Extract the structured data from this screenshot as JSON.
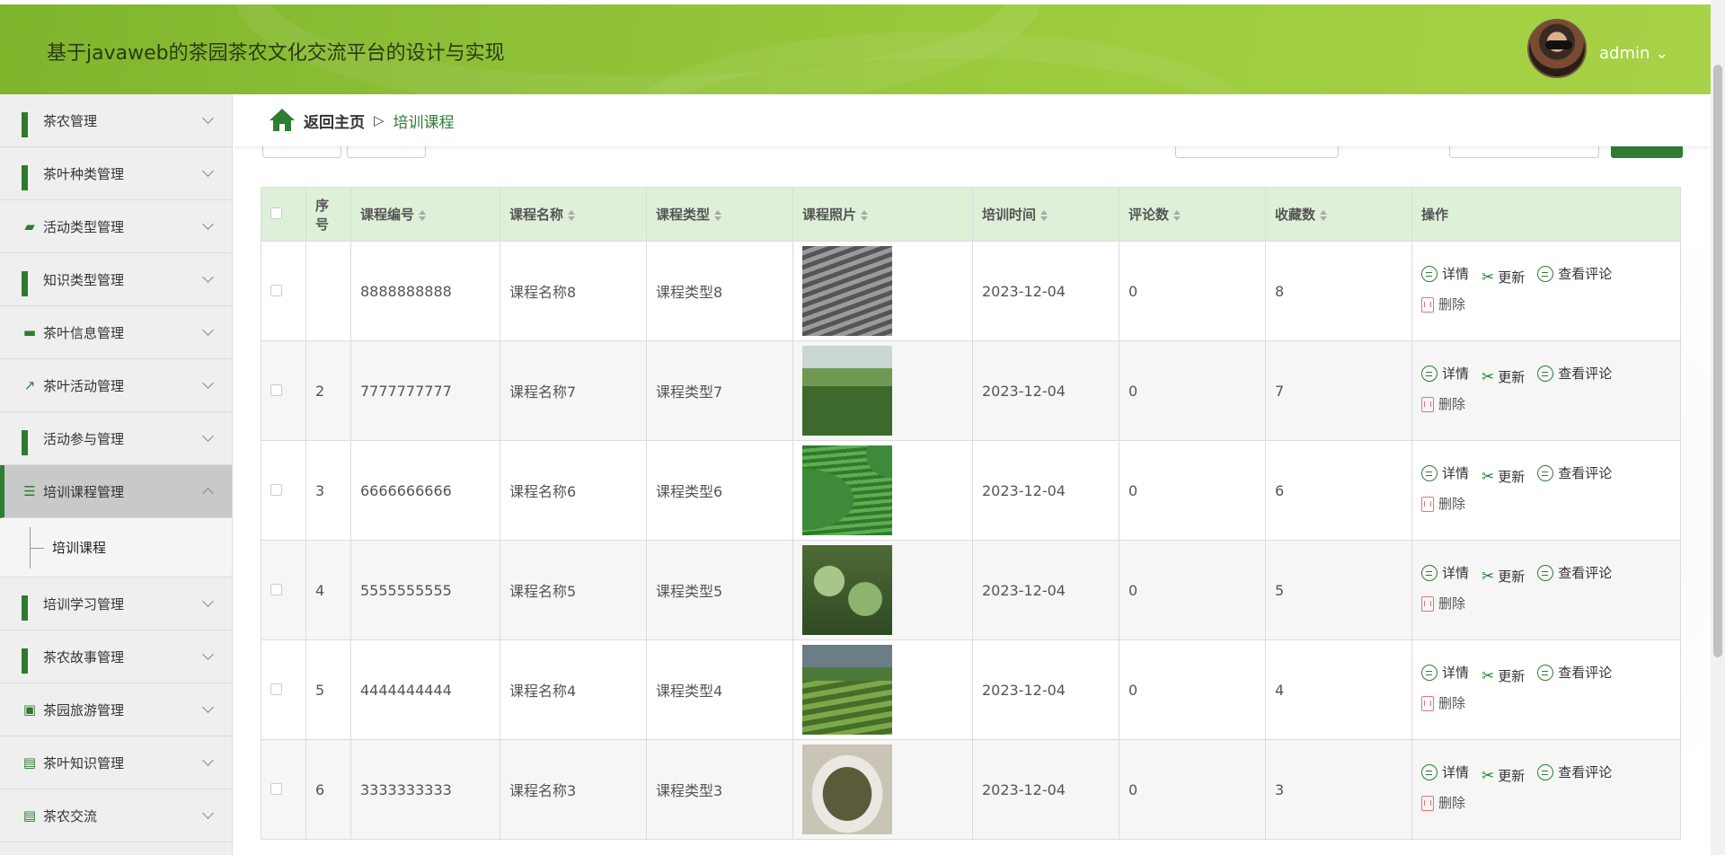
{
  "app": {
    "title": "基于javaweb的茶园茶农文化交流平台的设计与实现",
    "user": "admin ⌄"
  },
  "sidebar": {
    "items": [
      {
        "label": "茶农管理",
        "icon": "grid-icon"
      },
      {
        "label": "茶叶种类管理",
        "icon": "grid-icon"
      },
      {
        "label": "活动类型管理",
        "icon": "ticket-icon"
      },
      {
        "label": "知识类型管理",
        "icon": "grid-icon"
      },
      {
        "label": "茶叶信息管理",
        "icon": "comment-icon"
      },
      {
        "label": "茶叶活动管理",
        "icon": "chart-icon"
      },
      {
        "label": "活动参与管理",
        "icon": "grid-icon"
      },
      {
        "label": "培训课程管理",
        "icon": "list-icon",
        "active": true
      },
      {
        "label": "培训学习管理",
        "icon": "grid-icon"
      },
      {
        "label": "茶农故事管理",
        "icon": "grid-icon"
      },
      {
        "label": "茶园旅游管理",
        "icon": "briefcase-icon"
      },
      {
        "label": "茶叶知识管理",
        "icon": "clipboard-icon"
      },
      {
        "label": "茶农交流",
        "icon": "clipboard-icon"
      }
    ],
    "sub_item": "培训课程"
  },
  "breadcrumb": {
    "home": "返回主页",
    "separator": "▷",
    "current": "培训课程"
  },
  "table": {
    "headers": [
      "序号",
      "课程编号",
      "课程名称",
      "课程类型",
      "课程照片",
      "培训时间",
      "评论数",
      "收藏数",
      "操作"
    ],
    "actions": {
      "detail": "详情",
      "update": "更新",
      "comments": "查看评论",
      "delete": "删除"
    },
    "rows": [
      {
        "index": "",
        "code": "8888888888",
        "name": "课程名称8",
        "type": "课程类型8",
        "photo": "tea-terraces-bw",
        "date": "2023-12-04",
        "comments": "0",
        "favorites": "8"
      },
      {
        "index": "2",
        "code": "7777777777",
        "name": "课程名称7",
        "type": "课程类型7",
        "photo": "tea-field-sprinkler",
        "date": "2023-12-04",
        "comments": "0",
        "favorites": "7"
      },
      {
        "index": "3",
        "code": "6666666666",
        "name": "课程名称6",
        "type": "课程类型6",
        "photo": "tea-rows-curve",
        "date": "2023-12-04",
        "comments": "0",
        "favorites": "6"
      },
      {
        "index": "4",
        "code": "5555555555",
        "name": "课程名称5",
        "type": "课程类型5",
        "photo": "tea-leaves-closeup",
        "date": "2023-12-04",
        "comments": "0",
        "favorites": "5"
      },
      {
        "index": "5",
        "code": "4444444444",
        "name": "课程名称4",
        "type": "课程类型4",
        "photo": "tea-hill-rows",
        "date": "2023-12-04",
        "comments": "0",
        "favorites": "4"
      },
      {
        "index": "6",
        "code": "3333333333",
        "name": "课程名称3",
        "type": "课程类型3",
        "photo": "dried-tea-bowl",
        "date": "2023-12-04",
        "comments": "0",
        "favorites": "3"
      }
    ]
  },
  "colors": {
    "header_green": "#8dc037",
    "accent": "#2e7d32",
    "table_header": "#dff0d8",
    "delete": "#e57373"
  }
}
